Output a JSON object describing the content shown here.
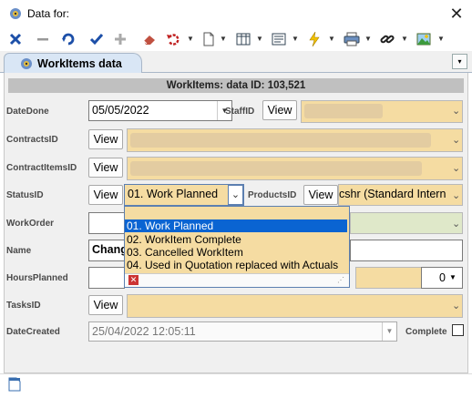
{
  "window": {
    "title": "Data for:",
    "close_glyph": "✕"
  },
  "toolbar": {
    "icons": [
      "close-x-icon",
      "minus-icon",
      "refresh-icon",
      "checkmark-icon",
      "plus-icon",
      "eraser-icon",
      "undo-icon",
      "document-icon",
      "grid-icon",
      "form-icon",
      "lightning-icon",
      "printer-icon",
      "link-icon",
      "picture-icon"
    ]
  },
  "tab": {
    "label": "WorkItems data",
    "dropdown_glyph": "▾"
  },
  "form": {
    "header": "WorkItems: data ID: 103,521",
    "labels": {
      "date_done": "DateDone",
      "staff_id": "StaffID",
      "contracts_id": "ContractsID",
      "contract_items_id": "ContractItemsID",
      "status_id": "StatusID",
      "products_id": "ProductsID",
      "work_order": "WorkOrder",
      "name": "Name",
      "hours_planned": "HoursPlanned",
      "tasks_id": "TasksID",
      "date_created": "DateCreated",
      "complete": "Complete"
    },
    "view_label": "View",
    "date_done_value": "05/05/2022",
    "status_value": "01. Work Planned",
    "products_value": "cshr (Standard Intern",
    "name_value": "Chang",
    "hours_value": "0",
    "date_created_value": "25/04/2022 12:05:11"
  },
  "status_options": [
    "01. Work Planned",
    "02. WorkItem Complete",
    "03. Cancelled WorkItem",
    "04. Used in Quotation replaced with Actuals"
  ],
  "colors": {
    "combo_fill": "#f5dca2",
    "selection": "#0a64d2",
    "tab_fill": "#d9e6f5"
  }
}
